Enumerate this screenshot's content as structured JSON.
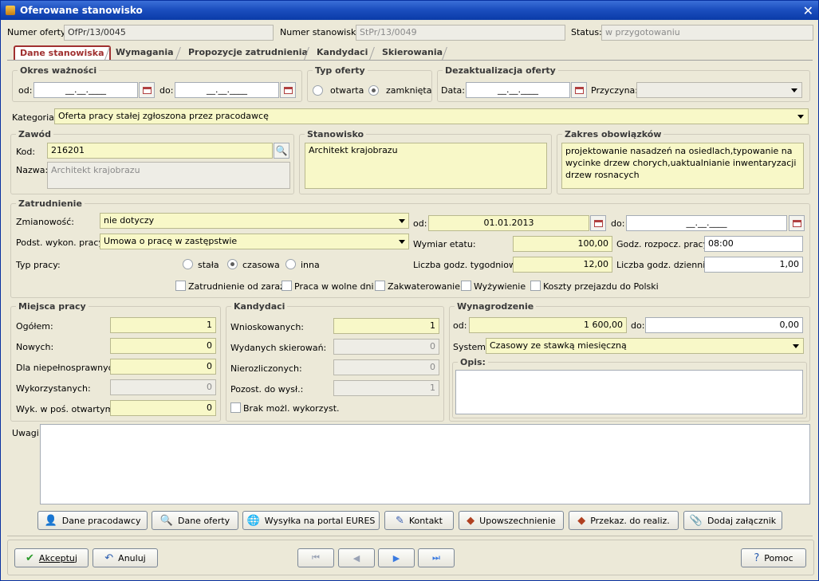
{
  "title": "Oferowane stanowisko",
  "header": {
    "numer_oferty_label": "Numer oferty:",
    "numer_oferty": "OfPr/13/0045",
    "numer_stanowiska_label": "Numer stanowiska:",
    "numer_stanowiska": "StPr/13/0049",
    "status_label": "Status:",
    "status": "w przygotowaniu"
  },
  "tabs": [
    "Dane stanowiska",
    "Wymagania",
    "Propozycje zatrudnienia",
    "Kandydaci",
    "Skierowania"
  ],
  "okres": {
    "legend": "Okres ważności",
    "od_label": "od:",
    "od": "__.__.____",
    "do_label": "do:",
    "do": "__.__.____"
  },
  "typ_oferty": {
    "legend": "Typ oferty",
    "opt1": "otwarta",
    "opt2": "zamknięta"
  },
  "dezakt": {
    "legend": "Dezaktualizacja oferty",
    "data_label": "Data:",
    "data": "__.__.____",
    "przyczyna_label": "Przyczyna:",
    "przyczyna": ""
  },
  "kategoria": {
    "label": "Kategoria:",
    "value": "Oferta pracy stałej zgłoszona przez pracodawcę"
  },
  "zawod": {
    "legend": "Zawód",
    "kod_label": "Kod:",
    "kod": "216201",
    "nazwa_label": "Nazwa:",
    "nazwa": "Architekt krajobrazu"
  },
  "stanowisko": {
    "legend": "Stanowisko",
    "value": "Architekt krajobrazu"
  },
  "zakres": {
    "legend": "Zakres obowiązków",
    "value": "projektowanie nasadzeń na osiedlach,typowanie na wycinke drzew chorych,uaktualnianie inwentaryzacji drzew rosnacych"
  },
  "zatrudnienie": {
    "legend": "Zatrudnienie",
    "zmianowosc_label": "Zmianowość:",
    "zmianowosc": "nie dotyczy",
    "od_label": "od:",
    "od": "01.01.2013",
    "do_label": "do:",
    "do": "__.__.____",
    "podst_label": "Podst. wykon. pracy:",
    "podst": "Umowa o pracę w zastępstwie",
    "wymiar_label": "Wymiar etatu:",
    "wymiar": "100,00",
    "godz_rozp_label": "Godz. rozpocz. pracy:",
    "godz_rozp": "08:00",
    "typ_label": "Typ pracy:",
    "typ1": "stała",
    "typ2": "czasowa",
    "typ3": "inna",
    "lgt_label": "Liczba godz. tygodniowo:",
    "lgt": "12,00",
    "lgd_label": "Liczba godz. dziennie:",
    "lgd": "1,00",
    "chk1": "Zatrudnienie od zaraz",
    "chk2": "Praca w wolne dni",
    "chk3": "Zakwaterowanie",
    "chk4": "Wyżywienie",
    "chk5": "Koszty przejazdu do Polski"
  },
  "miejsca": {
    "legend": "Miejsca pracy",
    "ogolem_label": "Ogółem:",
    "ogolem": "1",
    "nowych_label": "Nowych:",
    "nowych": "0",
    "niepeln_label": "Dla niepełnosprawnych:",
    "niepeln": "0",
    "wykorz_label": "Wykorzystanych:",
    "wykorz": "0",
    "wyk_otw_label": "Wyk. w poś. otwartym:",
    "wyk_otw": "0"
  },
  "kandydaci": {
    "legend": "Kandydaci",
    "wniosk_label": "Wnioskowanych:",
    "wniosk": "1",
    "wyd_label": "Wydanych skierowań:",
    "wyd": "0",
    "nierozl_label": "Nierozliczonych:",
    "nierozl": "0",
    "pozost_label": "Pozost. do wysł.:",
    "pozost": "1",
    "brak_label": "Brak możl. wykorzyst."
  },
  "wynagrodzenie": {
    "legend": "Wynagrodzenie",
    "od_label": "od:",
    "od": "1 600,00",
    "do_label": "do:",
    "do": "0,00",
    "system_label": "System:",
    "system": "Czasowy ze stawką miesięczną",
    "opis_legend": "Opis:"
  },
  "uwagi_label": "Uwagi:",
  "buttons": {
    "pracodawcy": "Dane pracodawcy",
    "oferty": "Dane oferty",
    "eures": "Wysyłka na portal EURES",
    "kontakt": "Kontakt",
    "upowsz": "Upowszechnienie",
    "przekaz": "Przekaz. do realiz.",
    "zalacznik": "Dodaj załącznik",
    "akceptuj": "Akceptuj",
    "anuluj": "Anuluj",
    "pomoc": "Pomoc"
  },
  "colors": {
    "title_bar": "#1c4fbf",
    "required_field": "#f8f8c8",
    "active_tab": "#a03030"
  }
}
